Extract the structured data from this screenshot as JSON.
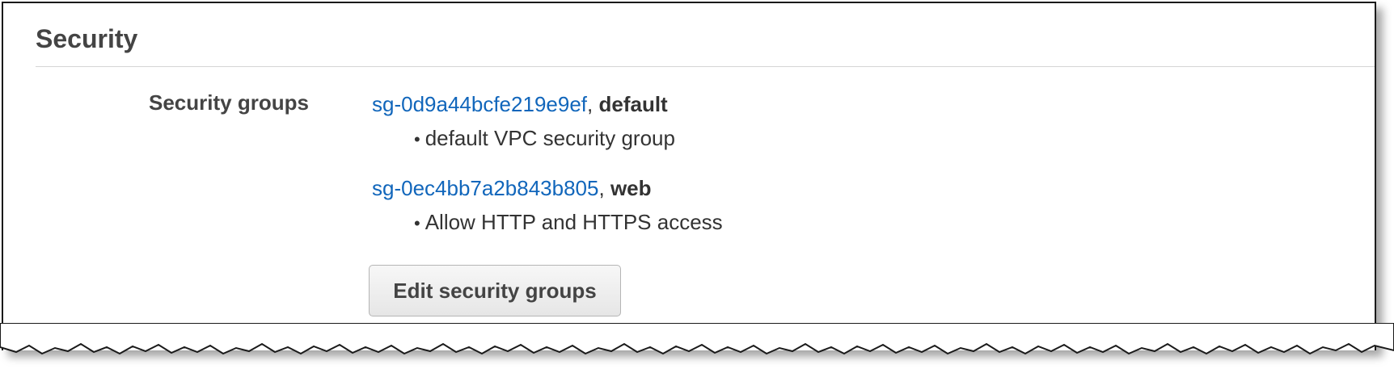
{
  "section": {
    "title": "Security"
  },
  "security_groups": {
    "label": "Security groups",
    "groups": [
      {
        "id": "sg-0d9a44bcfe219e9ef",
        "separator": ",",
        "name": "default",
        "bullet": "•",
        "description": "default VPC security group"
      },
      {
        "id": "sg-0ec4bb7a2b843b805",
        "separator": ",",
        "name": "web",
        "bullet": "•",
        "description": "Allow HTTP and HTTPS access"
      }
    ],
    "edit_button_label": "Edit security groups"
  },
  "colors": {
    "link": "#1166bb",
    "text": "#444444",
    "divider": "#d5d5d5"
  }
}
